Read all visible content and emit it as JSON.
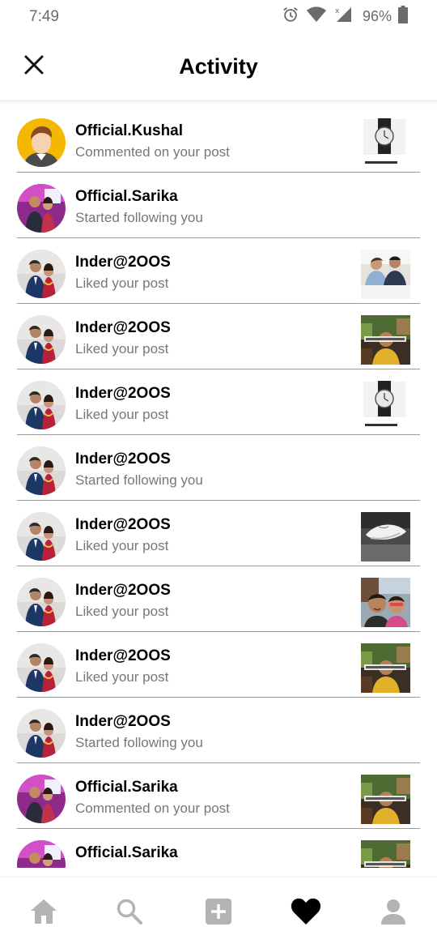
{
  "status_bar": {
    "time": "7:49",
    "battery": "96%",
    "icons": [
      "alarm-icon",
      "wifi-icon",
      "signal-icon",
      "battery-icon"
    ]
  },
  "header": {
    "title": "Activity",
    "close_icon": "close-icon"
  },
  "activities": [
    {
      "username": "Official.Kushal",
      "action": "Commented on your post",
      "avatar": "cartoon",
      "thumbnail": "watch"
    },
    {
      "username": "Official.Sarika",
      "action": "Started following you",
      "avatar": "couple-pink",
      "thumbnail": null
    },
    {
      "username": "Inder@2OOS",
      "action": "Liked your post",
      "avatar": "couple-gray",
      "thumbnail": "people"
    },
    {
      "username": "Inder@2OOS",
      "action": "Liked your post",
      "avatar": "couple-gray",
      "thumbnail": "meme"
    },
    {
      "username": "Inder@2OOS",
      "action": "Liked your post",
      "avatar": "couple-gray",
      "thumbnail": "watch"
    },
    {
      "username": "Inder@2OOS",
      "action": "Started following you",
      "avatar": "couple-gray",
      "thumbnail": null
    },
    {
      "username": "Inder@2OOS",
      "action": "Liked your post",
      "avatar": "couple-gray",
      "thumbnail": "shoe"
    },
    {
      "username": "Inder@2OOS",
      "action": "Liked your post",
      "avatar": "couple-gray",
      "thumbnail": "selfie"
    },
    {
      "username": "Inder@2OOS",
      "action": "Liked your post",
      "avatar": "couple-gray",
      "thumbnail": "meme"
    },
    {
      "username": "Inder@2OOS",
      "action": "Started following you",
      "avatar": "couple-gray",
      "thumbnail": null
    },
    {
      "username": "Official.Sarika",
      "action": "Commented on your post",
      "avatar": "couple-pink",
      "thumbnail": "meme"
    },
    {
      "username": "Official.Sarika",
      "action": "",
      "avatar": "couple-pink",
      "thumbnail": "meme"
    }
  ],
  "bottom_nav": [
    {
      "icon": "home-icon",
      "active": false
    },
    {
      "icon": "search-icon",
      "active": false
    },
    {
      "icon": "add-post-icon",
      "active": false
    },
    {
      "icon": "heart-icon",
      "active": true
    },
    {
      "icon": "profile-icon",
      "active": false
    }
  ],
  "colors": {
    "text_primary": "#000000",
    "text_secondary": "#777777",
    "divider": "#9a9a9a",
    "nav_inactive": "#b3b3b3",
    "nav_active": "#000000"
  }
}
